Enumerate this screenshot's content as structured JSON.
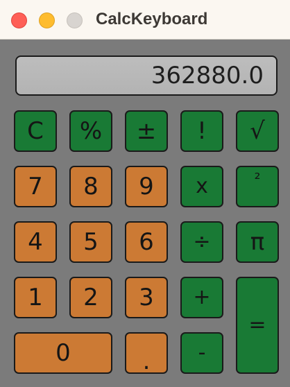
{
  "window": {
    "title": "CalcKeyboard",
    "controls": [
      "close",
      "minimize",
      "zoom"
    ]
  },
  "display": {
    "value": "362880.0"
  },
  "colors": {
    "function_key": "#197a35",
    "number_key": "#cc7a34",
    "body": "#7b7b7b",
    "display": "#b8b8b8"
  },
  "keys": {
    "clear": "C",
    "percent": "%",
    "plus_minus": "±",
    "factorial": "!",
    "sqrt": "√",
    "seven": "7",
    "eight": "8",
    "nine": "9",
    "multiply": "x",
    "square": "²",
    "four": "4",
    "five": "5",
    "six": "6",
    "divide": "÷",
    "pi": "π",
    "one": "1",
    "two": "2",
    "three": "3",
    "add": "+",
    "equals": "=",
    "zero": "0",
    "decimal": ".",
    "subtract": "-"
  }
}
